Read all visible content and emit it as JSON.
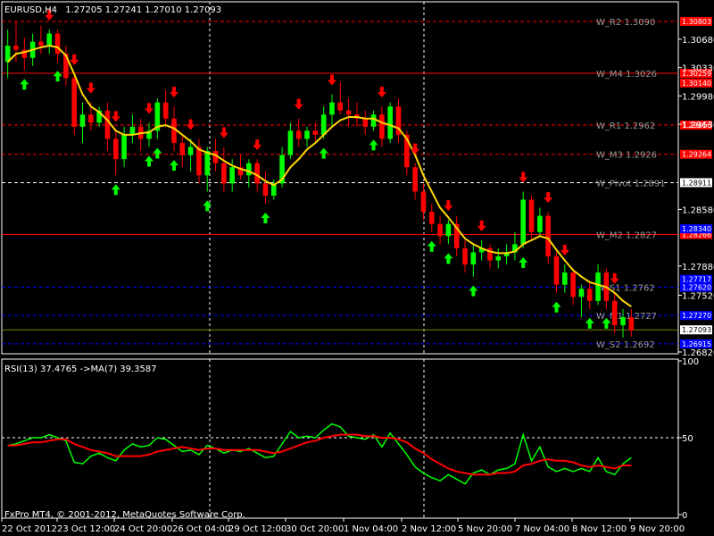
{
  "header": {
    "symbol": "EURUSD,H4",
    "ohlc": "1.27205 1.27241 1.27010 1.27093"
  },
  "footer": {
    "copyright": "FxPro MT4, © 2001-2012, MetaQuotes Software Corp."
  },
  "colors": {
    "background": "#000000",
    "bull": "#00ff00",
    "bear": "#ff0000",
    "ma": "#ffd700",
    "rsi": "#00ff00",
    "rsi_ma": "#ff0000",
    "grid": "#ffffff",
    "pivot_red": "#ff0000",
    "pivot_blue": "#0000ff",
    "pivot_white": "#ffffff",
    "price_line": "#808000"
  },
  "chart_data": [
    {
      "type": "candlestick",
      "title": "EURUSD,H4",
      "ylim": [
        1.2682,
        1.3112
      ],
      "y_ticks": [
        "1.30680",
        "1.30330",
        "1.29980",
        "1.29630",
        "1.28580",
        "1.27880",
        "1.27520",
        "1.26820"
      ],
      "x_ticks": [
        "22 Oct 2012",
        "23 Oct 12:00",
        "24 Oct 20:00",
        "26 Oct 04:00",
        "29 Oct 12:00",
        "30 Oct 20:00",
        "1 Nov 04:00",
        "2 Nov 12:00",
        "5 Nov 20:00",
        "7 Nov 04:00",
        "8 Nov 12:00",
        "9 Nov 20:00"
      ],
      "current_price": "1.27093",
      "candles": [
        [
          1.304,
          1.308,
          1.302,
          1.306
        ],
        [
          1.306,
          1.309,
          1.304,
          1.3055
        ],
        [
          1.3055,
          1.307,
          1.303,
          1.3045
        ],
        [
          1.3045,
          1.3075,
          1.3035,
          1.3065
        ],
        [
          1.3065,
          1.3085,
          1.305,
          1.306
        ],
        [
          1.306,
          1.308,
          1.305,
          1.3075
        ],
        [
          1.3075,
          1.308,
          1.304,
          1.305
        ],
        [
          1.305,
          1.306,
          1.301,
          1.302
        ],
        [
          1.302,
          1.3025,
          1.295,
          1.296
        ],
        [
          1.296,
          1.299,
          1.294,
          1.2975
        ],
        [
          1.2975,
          1.299,
          1.2955,
          1.2965
        ],
        [
          1.2965,
          1.2985,
          1.296,
          1.298
        ],
        [
          1.298,
          1.299,
          1.293,
          1.2945
        ],
        [
          1.2945,
          1.2955,
          1.29,
          1.292
        ],
        [
          1.292,
          1.296,
          1.291,
          1.295
        ],
        [
          1.295,
          1.2975,
          1.294,
          1.296
        ],
        [
          1.296,
          1.297,
          1.293,
          1.2945
        ],
        [
          1.2945,
          1.2965,
          1.2935,
          1.2955
        ],
        [
          1.2955,
          1.2995,
          1.2945,
          1.299
        ],
        [
          1.299,
          1.3005,
          1.296,
          1.297
        ],
        [
          1.297,
          1.2985,
          1.293,
          1.294
        ],
        [
          1.294,
          1.295,
          1.291,
          1.2925
        ],
        [
          1.2925,
          1.2945,
          1.2905,
          1.2935
        ],
        [
          1.2935,
          1.2945,
          1.289,
          1.29
        ],
        [
          1.29,
          1.2935,
          1.288,
          1.293
        ],
        [
          1.293,
          1.2945,
          1.2905,
          1.2915
        ],
        [
          1.2915,
          1.2935,
          1.288,
          1.289
        ],
        [
          1.289,
          1.292,
          1.288,
          1.291
        ],
        [
          1.291,
          1.2925,
          1.2895,
          1.29
        ],
        [
          1.29,
          1.292,
          1.2885,
          1.2915
        ],
        [
          1.2915,
          1.292,
          1.288,
          1.289
        ],
        [
          1.289,
          1.2905,
          1.2865,
          1.2875
        ],
        [
          1.2875,
          1.2895,
          1.287,
          1.289
        ],
        [
          1.289,
          1.2935,
          1.2885,
          1.2925
        ],
        [
          1.2925,
          1.2965,
          1.292,
          1.2955
        ],
        [
          1.2955,
          1.297,
          1.2935,
          1.2945
        ],
        [
          1.2945,
          1.296,
          1.2935,
          1.2955
        ],
        [
          1.2955,
          1.2965,
          1.294,
          1.295
        ],
        [
          1.295,
          1.2985,
          1.2945,
          1.2975
        ],
        [
          1.2975,
          1.3,
          1.296,
          1.299
        ],
        [
          1.299,
          1.3015,
          1.2975,
          1.298
        ],
        [
          1.298,
          1.2995,
          1.296,
          1.2975
        ],
        [
          1.2975,
          1.299,
          1.296,
          1.297
        ],
        [
          1.297,
          1.298,
          1.295,
          1.296
        ],
        [
          1.296,
          1.298,
          1.2955,
          1.2975
        ],
        [
          1.2975,
          1.2985,
          1.2935,
          1.2945
        ],
        [
          1.2945,
          1.299,
          1.294,
          1.2985
        ],
        [
          1.2985,
          1.2995,
          1.294,
          1.295
        ],
        [
          1.295,
          1.2955,
          1.29,
          1.291
        ],
        [
          1.291,
          1.2915,
          1.287,
          1.288
        ],
        [
          1.288,
          1.289,
          1.2845,
          1.2855
        ],
        [
          1.2855,
          1.2865,
          1.283,
          1.284
        ],
        [
          1.284,
          1.285,
          1.2815,
          1.2825
        ],
        [
          1.2825,
          1.2845,
          1.2815,
          1.284
        ],
        [
          1.284,
          1.285,
          1.28,
          1.281
        ],
        [
          1.281,
          1.282,
          1.278,
          1.279
        ],
        [
          1.279,
          1.2815,
          1.2775,
          1.2805
        ],
        [
          1.2805,
          1.282,
          1.2795,
          1.281
        ],
        [
          1.281,
          1.2815,
          1.2785,
          1.2795
        ],
        [
          1.2795,
          1.281,
          1.2785,
          1.28
        ],
        [
          1.28,
          1.2815,
          1.279,
          1.2805
        ],
        [
          1.2805,
          1.283,
          1.2795,
          1.2815
        ],
        [
          1.2815,
          1.288,
          1.281,
          1.287
        ],
        [
          1.287,
          1.2875,
          1.282,
          1.283
        ],
        [
          1.283,
          1.286,
          1.2825,
          1.285
        ],
        [
          1.285,
          1.2855,
          1.279,
          1.28
        ],
        [
          1.28,
          1.2805,
          1.2755,
          1.2765
        ],
        [
          1.2765,
          1.279,
          1.2755,
          1.278
        ],
        [
          1.278,
          1.2785,
          1.274,
          1.275
        ],
        [
          1.275,
          1.2765,
          1.2725,
          1.276
        ],
        [
          1.276,
          1.277,
          1.2735,
          1.2745
        ],
        [
          1.2745,
          1.279,
          1.274,
          1.278
        ],
        [
          1.278,
          1.2785,
          1.2735,
          1.2745
        ],
        [
          1.2745,
          1.2755,
          1.2705,
          1.2715
        ],
        [
          1.2715,
          1.2735,
          1.27,
          1.2725
        ],
        [
          1.2725,
          1.2735,
          1.2701,
          1.2709
        ]
      ],
      "ma_values": [
        1.304,
        1.305,
        1.3052,
        1.3055,
        1.3058,
        1.306,
        1.3058,
        1.3048,
        1.3025,
        1.3,
        1.2985,
        1.2978,
        1.2968,
        1.2955,
        1.295,
        1.295,
        1.2952,
        1.2953,
        1.296,
        1.2962,
        1.2958,
        1.295,
        1.2942,
        1.2932,
        1.2928,
        1.2925,
        1.2918,
        1.2912,
        1.2908,
        1.2905,
        1.29,
        1.2893,
        1.2888,
        1.2895,
        1.291,
        1.292,
        1.2932,
        1.294,
        1.295,
        1.296,
        1.2968,
        1.2972,
        1.2972,
        1.297,
        1.297,
        1.2965,
        1.2962,
        1.2958,
        1.2945,
        1.2925,
        1.29,
        1.288,
        1.286,
        1.2848,
        1.2835,
        1.2822,
        1.2815,
        1.281,
        1.2806,
        1.2804,
        1.2804,
        1.2806,
        1.2815,
        1.282,
        1.2825,
        1.2822,
        1.2808,
        1.2795,
        1.2783,
        1.2775,
        1.2768,
        1.2765,
        1.2762,
        1.2755,
        1.2745,
        1.2738
      ],
      "pivots": [
        {
          "name": "W_R2",
          "label": "W_R2 1.3090",
          "price_tag": "1.30803",
          "value": 1.309,
          "color": "#ff0000"
        },
        {
          "name": "W_M4",
          "label": "W_M4 1.3026",
          "price_tag": "1.30259",
          "value": 1.3026,
          "color": "#ff0000"
        },
        {
          "name": "W_R1",
          "label": "W_R1 1.2962",
          "price_tag": "1.29616",
          "value": 1.2962,
          "color": "#ff0000"
        },
        {
          "name": "W_M3",
          "label": "W_M3 1.2926",
          "price_tag": "1.29264",
          "value": 1.2926,
          "color": "#ff0000"
        },
        {
          "name": "W_Pivot",
          "label": "W_Pivot 1.2891",
          "price_tag": "1.28911",
          "value": 1.2891,
          "color": "#ffffff"
        },
        {
          "name": "W_M2",
          "label": "W_M2 1.2827",
          "price_tag": "1.28266",
          "value": 1.2827,
          "color": "#ff0000"
        },
        {
          "name": "W_S1",
          "label": "W_S1 1.2762",
          "price_tag": "1.27620",
          "value": 1.2762,
          "color": "#0000ff"
        },
        {
          "name": "W_M1",
          "label": "W_M1 1.2727",
          "price_tag": "1.27270",
          "value": 1.2727,
          "color": "#0000ff"
        },
        {
          "name": "W_S2",
          "label": "W_S2 1.2692",
          "price_tag": "1.26915",
          "value": 1.2692,
          "color": "#0000ff"
        }
      ],
      "extra_price_tags": [
        {
          "text": "1.30140",
          "value": 1.3014,
          "color": "#ff0000"
        },
        {
          "text": "1.28340",
          "value": 1.2834,
          "color": "#0000ff"
        },
        {
          "text": "1.27717",
          "value": 1.27717,
          "color": "#0000ff"
        }
      ]
    },
    {
      "type": "line",
      "title": "RSI(13) 37.4765  ->MA(7) 39.3587",
      "ylim": [
        0,
        100
      ],
      "y_ticks": [
        "100",
        "50",
        "0"
      ],
      "level": 50,
      "series": [
        {
          "name": "RSI(13) 37.4765",
          "color": "#00ff00",
          "values": [
            45,
            46,
            48,
            50,
            50,
            52,
            50,
            48,
            34,
            33,
            38,
            40,
            37,
            35,
            42,
            46,
            44,
            45,
            50,
            49,
            45,
            41,
            42,
            39,
            45,
            43,
            40,
            42,
            41,
            43,
            40,
            37,
            38,
            46,
            54,
            50,
            51,
            50,
            55,
            59,
            57,
            51,
            50,
            49,
            52,
            44,
            53,
            46,
            39,
            31,
            27,
            24,
            22,
            26,
            23,
            20,
            27,
            29,
            26,
            29,
            30,
            33,
            52,
            35,
            44,
            31,
            28,
            30,
            28,
            30,
            28,
            37,
            28,
            26,
            33,
            37
          ]
        },
        {
          "name": "->MA(7) 39.3587",
          "color": "#ff0000",
          "values": [
            45,
            45,
            46,
            47,
            47,
            48,
            49,
            49,
            46,
            44,
            42,
            41,
            40,
            38,
            38,
            38,
            38,
            39,
            41,
            42,
            43,
            44,
            43,
            42,
            43,
            43,
            42,
            42,
            42,
            42,
            42,
            41,
            40,
            41,
            43,
            45,
            47,
            48,
            50,
            51,
            52,
            52,
            52,
            51,
            51,
            50,
            50,
            49,
            47,
            43,
            40,
            36,
            33,
            30,
            28,
            27,
            26,
            26,
            26,
            27,
            27,
            28,
            32,
            33,
            35,
            36,
            35,
            35,
            34,
            32,
            31,
            32,
            31,
            30,
            32,
            32
          ]
        }
      ],
      "x_ticks": [
        "22 Oct 2012",
        "23 Oct 12:00",
        "24 Oct 20:00",
        "26 Oct 04:00",
        "29 Oct 12:00",
        "30 Oct 20:00",
        "1 Nov 04:00",
        "2 Nov 12:00",
        "5 Nov 20:00",
        "7 Nov 04:00",
        "8 Nov 12:00",
        "9 Nov 20:00"
      ]
    }
  ],
  "fractal_signals": {
    "up": [
      2,
      6,
      13,
      17,
      18,
      20,
      24,
      31,
      38,
      44,
      51,
      53,
      56,
      62,
      66,
      70,
      72
    ],
    "down": [
      5,
      8,
      10,
      13,
      17,
      20,
      22,
      26,
      30,
      35,
      39,
      45,
      49,
      53,
      57,
      62,
      65,
      67,
      73
    ]
  }
}
